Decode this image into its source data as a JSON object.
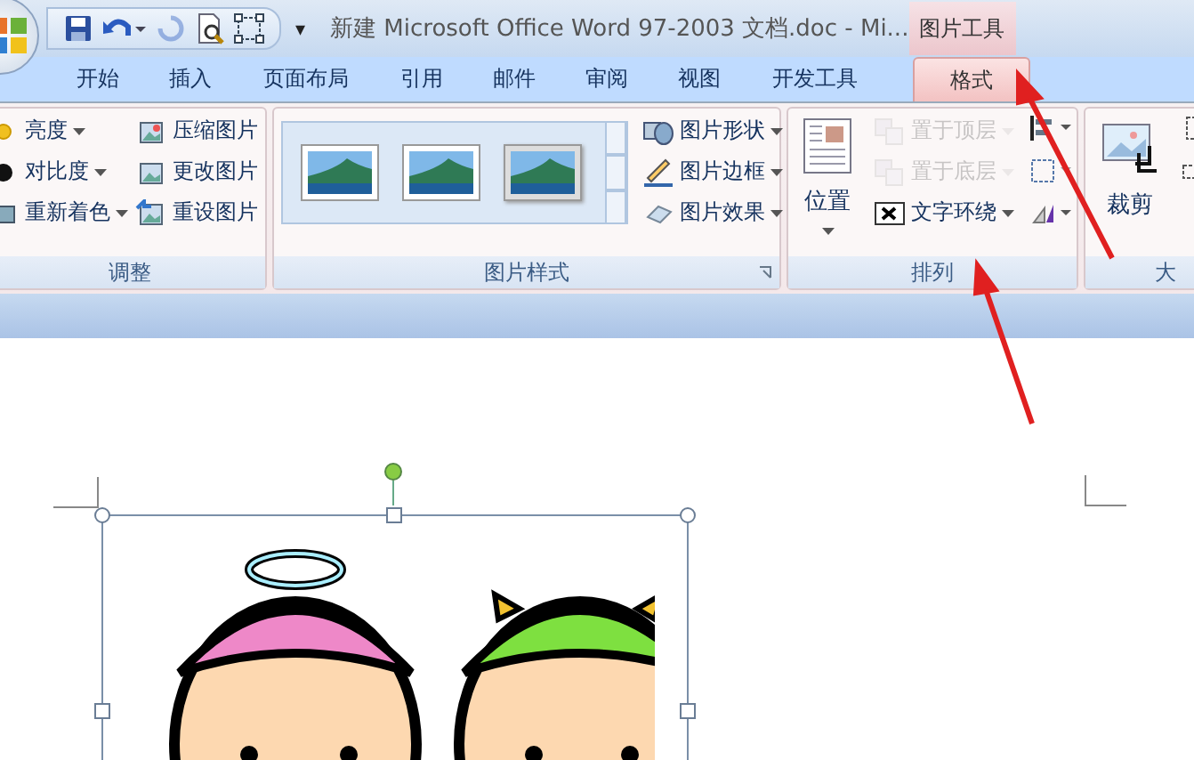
{
  "window": {
    "title": "新建 Microsoft Office Word 97-2003 文档.doc - Mi...",
    "context_tab": "图片工具"
  },
  "quick_access": [
    {
      "kind": "save",
      "disabled": false
    },
    {
      "kind": "undo",
      "disabled": false
    },
    {
      "kind": "redo",
      "disabled": true
    },
    {
      "kind": "preview",
      "disabled": false
    },
    {
      "kind": "select",
      "disabled": false
    }
  ],
  "customize": "▾",
  "tabs": [
    {
      "label": "开始",
      "selected": false
    },
    {
      "label": "插入",
      "selected": false
    },
    {
      "label": "页面布局",
      "selected": false
    },
    {
      "label": "引用",
      "selected": false
    },
    {
      "label": "邮件",
      "selected": false
    },
    {
      "label": "审阅",
      "selected": false
    },
    {
      "label": "视图",
      "selected": false
    },
    {
      "label": "开发工具",
      "selected": false
    },
    {
      "label": "格式",
      "selected": true
    }
  ],
  "adjust": {
    "label": "调整",
    "left": [
      {
        "label": "亮度",
        "kind": "sun",
        "dropdown": true
      },
      {
        "label": "对比度",
        "kind": "contrast",
        "dropdown": true
      },
      {
        "label": "重新着色",
        "kind": "recolor",
        "dropdown": true
      }
    ],
    "right": [
      {
        "label": "压缩图片",
        "kind": "compress"
      },
      {
        "label": "更改图片",
        "kind": "change"
      },
      {
        "label": "重设图片",
        "kind": "reset"
      }
    ]
  },
  "styles": {
    "label": "图片样式",
    "thumbnails": [
      {
        "kind": "plain",
        "selected": false
      },
      {
        "kind": "frame",
        "selected": false
      },
      {
        "kind": "shadow",
        "selected": false
      }
    ],
    "items": [
      {
        "label": "图片形状",
        "kind": "shape"
      },
      {
        "label": "图片边框",
        "kind": "border"
      },
      {
        "label": "图片效果",
        "kind": "effect"
      }
    ]
  },
  "arrange": {
    "label": "排列",
    "position": "位置",
    "items": [
      {
        "label": "置于顶层",
        "kind": "front",
        "disabled": true
      },
      {
        "label": "置于底层",
        "kind": "back",
        "disabled": true
      },
      {
        "label": "文字环绕",
        "kind": "wrap",
        "disabled": false
      }
    ]
  },
  "crop": {
    "label": "裁剪"
  },
  "size_group": {
    "label": "大"
  }
}
